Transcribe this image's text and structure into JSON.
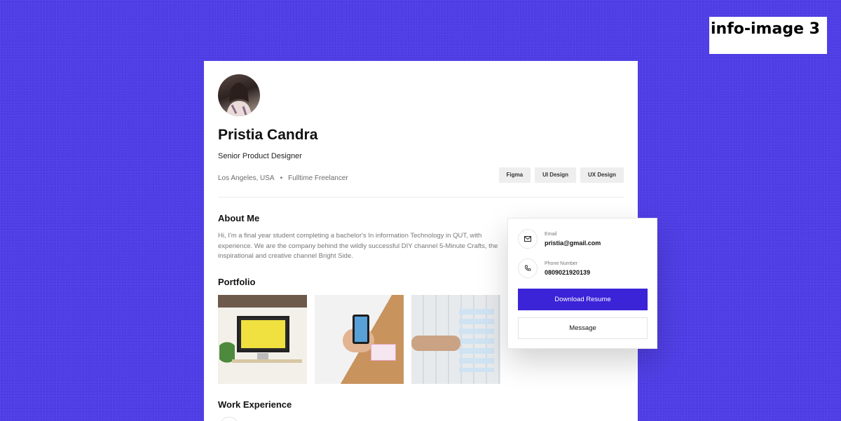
{
  "overlay_label": "info-image 3",
  "colors": {
    "background": "#4f3ee6",
    "accent": "#3b23d8",
    "card": "#ffffff"
  },
  "profile": {
    "name": "Pristia Candra",
    "role": "Senior Product Designer",
    "location": "Los Angeles, USA",
    "separator": "•",
    "employment": "Fulltime Freelancer",
    "tags": [
      "Figma",
      "UI Design",
      "UX Design"
    ]
  },
  "about": {
    "title": "About Me",
    "text": "Hi, I'm a final year student completing a bachelor's In information Technology in QUT, with experience. We are the company behind the wildly successful DIY channel 5-Minute Crafts, the inspirational and creative channel Bright Side."
  },
  "portfolio": {
    "title": "Portfolio"
  },
  "work": {
    "title": "Work Experience"
  },
  "contact": {
    "email_label": "Email",
    "email_value": "pristia@gmail.com",
    "email_icon": "mail-icon",
    "phone_label": "Phone Number",
    "phone_value": "0809021920139",
    "phone_icon": "phone-icon",
    "download_button": "Download Resume",
    "message_button": "Message"
  }
}
